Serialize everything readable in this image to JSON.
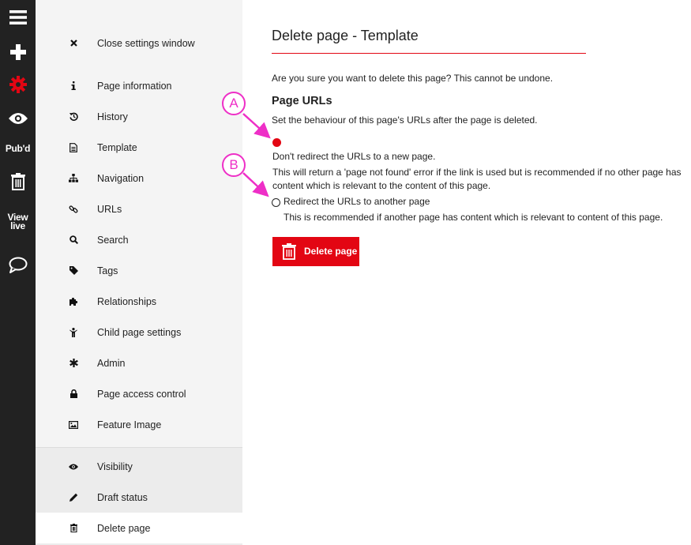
{
  "toolbar": {
    "items": [
      {
        "name": "menu-icon"
      },
      {
        "name": "plus-icon"
      },
      {
        "name": "gear-icon",
        "color": "#e30613"
      },
      {
        "name": "eye-icon"
      },
      {
        "name": "publish-status",
        "label": "Pub'd"
      },
      {
        "name": "trash-icon"
      },
      {
        "name": "view-live",
        "label": "View\nlive"
      },
      {
        "name": "comment-icon"
      }
    ]
  },
  "menu": {
    "close_label": "Close settings window",
    "items": [
      {
        "icon": "info-icon",
        "label": "Page information"
      },
      {
        "icon": "history-icon",
        "label": "History"
      },
      {
        "icon": "document-icon",
        "label": "Template"
      },
      {
        "icon": "sitemap-icon",
        "label": "Navigation"
      },
      {
        "icon": "link-icon",
        "label": "URLs"
      },
      {
        "icon": "search-icon",
        "label": "Search"
      },
      {
        "icon": "tag-icon",
        "label": "Tags"
      },
      {
        "icon": "puzzle-icon",
        "label": "Relationships"
      },
      {
        "icon": "child-icon",
        "label": "Child page settings"
      },
      {
        "icon": "asterisk-icon",
        "label": "Admin"
      },
      {
        "icon": "lock-icon",
        "label": "Page access control"
      },
      {
        "icon": "image-icon",
        "label": "Feature Image"
      }
    ],
    "bottom_items": [
      {
        "icon": "eye-icon",
        "label": "Visibility"
      },
      {
        "icon": "pencil-icon",
        "label": "Draft status"
      },
      {
        "icon": "trash-icon",
        "label": "Delete page",
        "active": true
      }
    ]
  },
  "main": {
    "title": "Delete page - Template",
    "confirm_text": "Are you sure you want to delete this page? This cannot be undone.",
    "section_title": "Page URLs",
    "section_desc": "Set the behaviour of this page's URLs after the page is deleted.",
    "options": [
      {
        "label": "Don't redirect the URLs to a new page.",
        "desc_line1": "This will return a 'page not found' error if the link is used but is recommended if no other page has",
        "desc_line2": "content which is relevant to the content of this page.",
        "checked": true
      },
      {
        "label": "Redirect the URLs to another page",
        "desc_line1": "This is recommended if another page has content which is relevant to content of this page.",
        "checked": false
      }
    ],
    "delete_button_label": "Delete page"
  },
  "annotations": {
    "a": "A",
    "b": "B",
    "color": "#ee2fc7"
  },
  "colors": {
    "accent": "#e30613",
    "toolbar_bg": "#222222",
    "menu_bg": "#f4f4f4"
  }
}
